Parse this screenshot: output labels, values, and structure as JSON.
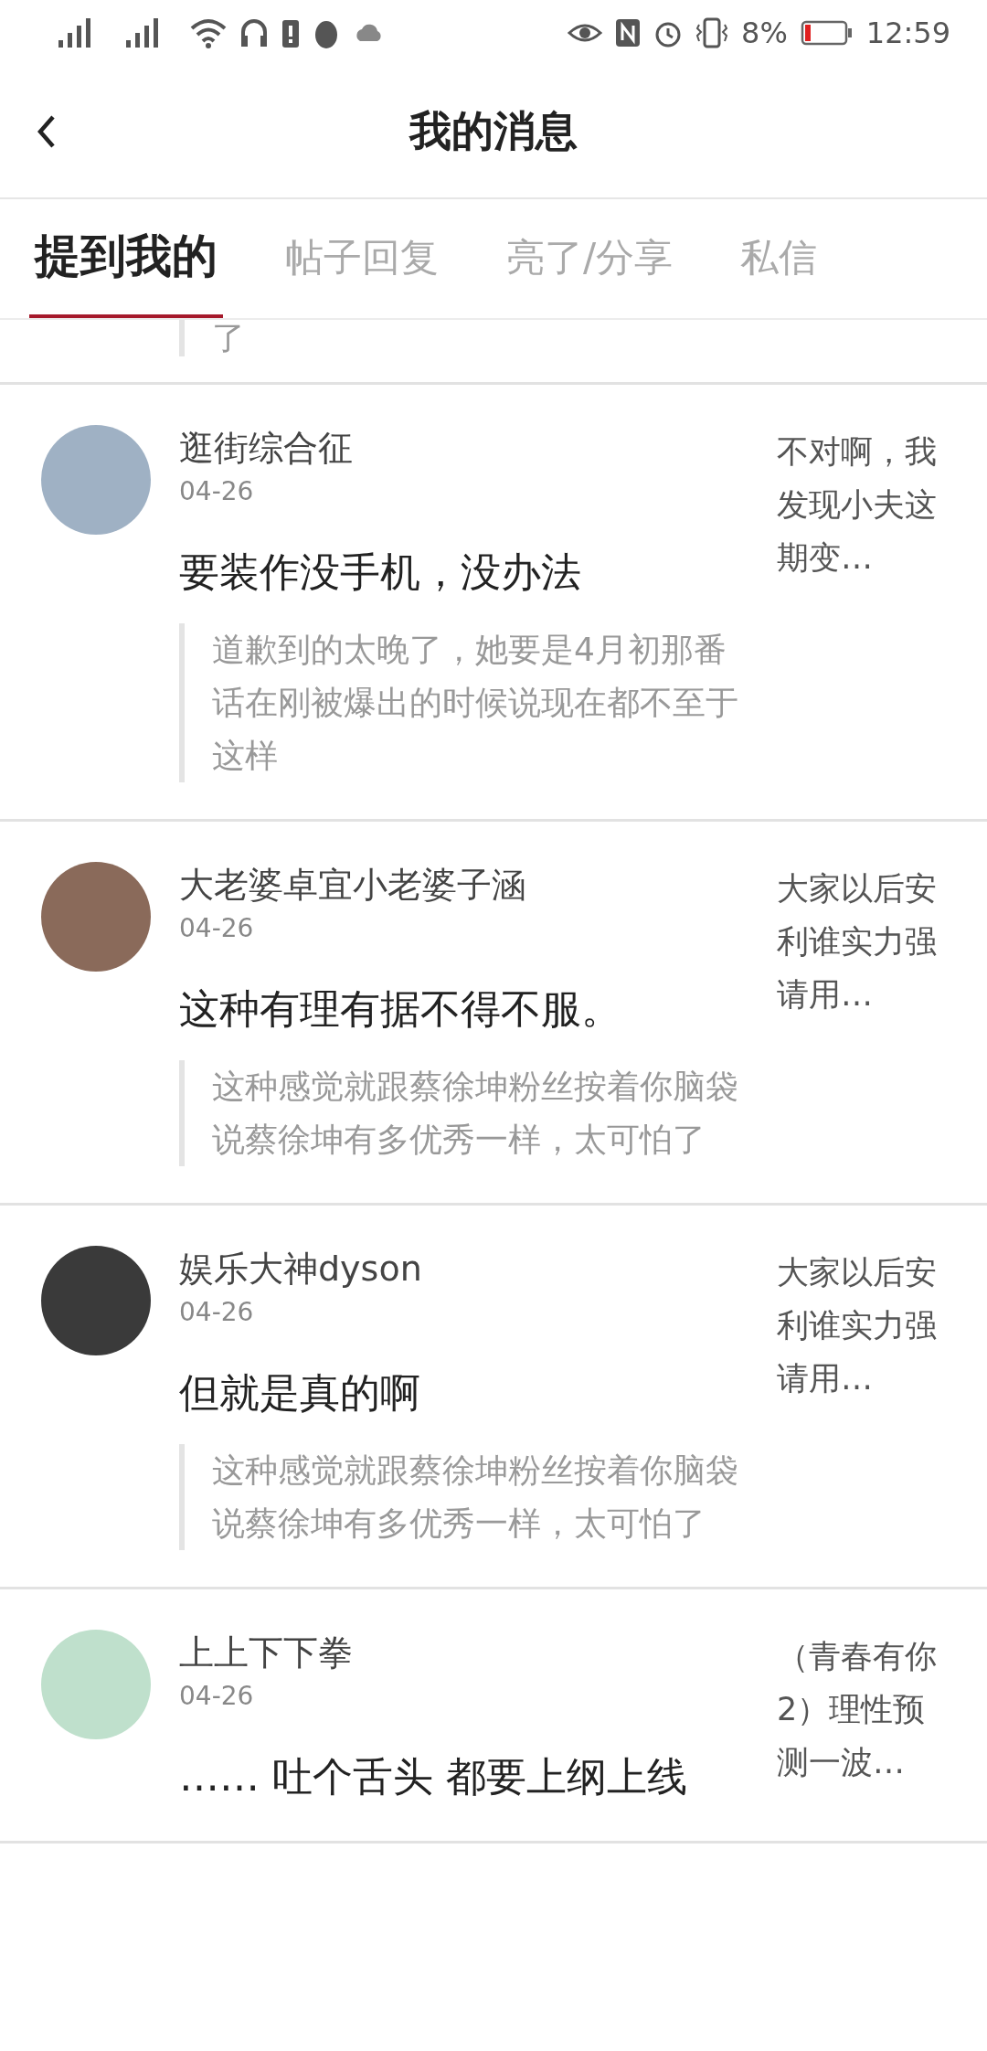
{
  "status_bar": {
    "battery": "8%",
    "time": "12:59"
  },
  "header": {
    "title": "我的消息"
  },
  "tabs": [
    {
      "label": "提到我的",
      "selected": true
    },
    {
      "label": "帖子回复",
      "selected": false
    },
    {
      "label": "亮了/分享",
      "selected": false
    },
    {
      "label": "私信",
      "selected": false
    }
  ],
  "partial_item": {
    "quote": "了"
  },
  "messages": [
    {
      "name": "逛街综合征",
      "date": "04-26",
      "content": "要装作没手机，没办法",
      "quote": "道歉到的太晚了，她要是4月初那番话在刚被爆出的时候说现在都不至于这样",
      "thread": "不对啊，我发现小夫这期变…"
    },
    {
      "name": "大老婆卓宜小老婆子涵",
      "date": "04-26",
      "content": "这种有理有据不得不服。",
      "quote": "这种感觉就跟蔡徐坤粉丝按着你脑袋说蔡徐坤有多优秀一样，太可怕了",
      "thread": "大家以后安利谁实力强请用…"
    },
    {
      "name": "娱乐大神dyson",
      "date": "04-26",
      "content": "但就是真的啊",
      "quote": "这种感觉就跟蔡徐坤粉丝按着你脑袋说蔡徐坤有多优秀一样，太可怕了",
      "thread": "大家以后安利谁实力强请用…"
    },
    {
      "name": "上上下下拳",
      "date": "04-26",
      "content": "…… 吐个舌头 都要上纲上线",
      "thread": "（青春有你2）理性预测一波…"
    }
  ]
}
